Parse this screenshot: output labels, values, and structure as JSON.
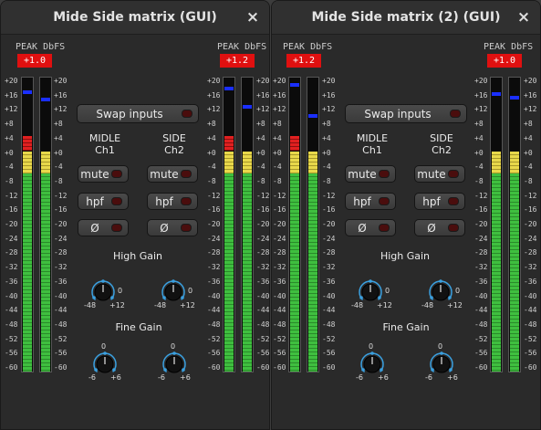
{
  "windows": [
    {
      "title": "Mide Side matrix (GUI)",
      "peak_header": "PEAK DbFS",
      "peak_left": "+1.0",
      "peak_right": "+1.2",
      "swap_label": "Swap inputs",
      "col1_name": "MIDLE",
      "col1_ch": "Ch1",
      "col2_name": "SIDE",
      "col2_ch": "Ch2",
      "mute_label": "mute",
      "hpf_label": "hpf",
      "phase_label": "Ø",
      "high_gain_title": "High Gain",
      "high_gain_min": "-48",
      "high_gain_mid": "0",
      "high_gain_max": "+12",
      "fine_gain_title": "Fine Gain",
      "fine_gain_min": "-6",
      "fine_gain_mid": "0",
      "fine_gain_max": "+6"
    },
    {
      "title": "Mide Side matrix (2) (GUI)",
      "peak_header": "PEAK DbFS",
      "peak_left": "+1.2",
      "peak_right": "+1.0",
      "swap_label": "Swap inputs",
      "col1_name": "MIDLE",
      "col1_ch": "Ch1",
      "col2_name": "SIDE",
      "col2_ch": "Ch2",
      "mute_label": "mute",
      "hpf_label": "hpf",
      "phase_label": "Ø",
      "high_gain_title": "High Gain",
      "high_gain_min": "-48",
      "high_gain_mid": "0",
      "high_gain_max": "+12",
      "fine_gain_title": "Fine Gain",
      "fine_gain_min": "-6",
      "fine_gain_mid": "0",
      "fine_gain_max": "+6"
    }
  ],
  "scale_ticks": [
    "+20",
    "+16",
    "+12",
    "+8",
    "+4",
    "+0",
    "-4",
    "-8",
    "-12",
    "-16",
    "-20",
    "-24",
    "-28",
    "-32",
    "-36",
    "-40",
    "-44",
    "-48",
    "-52",
    "-56",
    "-60"
  ],
  "close_glyph": "×",
  "meter_levels_db": [
    {
      "left_a": 4,
      "left_b": 0,
      "right_a": 4,
      "right_b": 0
    },
    {
      "left_a": 4,
      "left_b": 0,
      "right_a": 0,
      "right_b": 0
    }
  ],
  "colors": {
    "peak_red": "#e01010",
    "meter_green": "#3fbf3f",
    "meter_yellow": "#e8d84a",
    "meter_red": "#e02020",
    "peak_hold_blue": "#1a2fff",
    "knob_accent": "#3aa0e0"
  }
}
